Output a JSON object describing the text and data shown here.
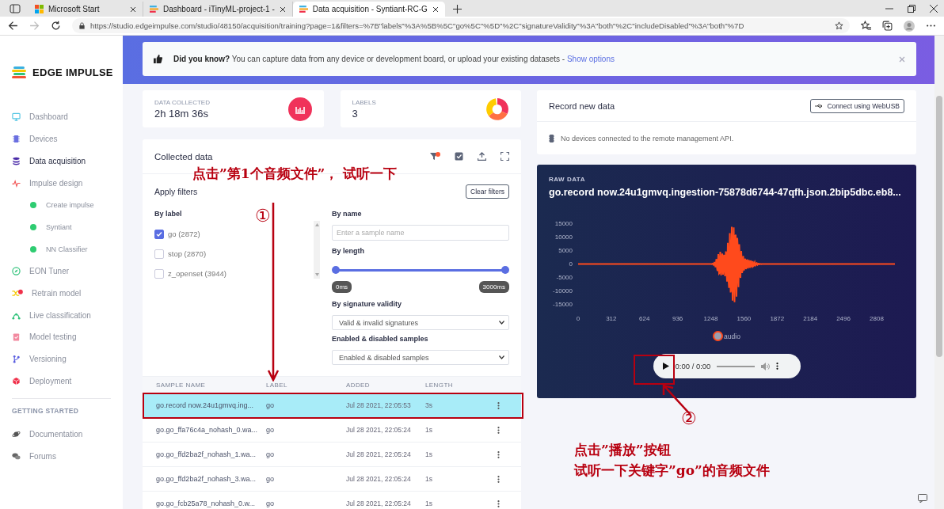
{
  "browser": {
    "tabs": [
      {
        "title": "Microsoft Start",
        "selected": false
      },
      {
        "title": "Dashboard - iTinyML-project-1 -",
        "selected": false
      },
      {
        "title": "Data acquisition - Syntiant-RC-G",
        "selected": true
      }
    ],
    "url": "https://studio.edgeimpulse.com/studio/48150/acquisition/training?page=1&filters=%7B\"labels\"%3A%5B%5C\"go%5C\"%5D\"%2C\"signatureValidity\"%3A\"both\"%2C\"includeDisabled\"%3A\"both\"%7D"
  },
  "sidebar": {
    "logo": "EDGE IMPULSE",
    "items": [
      {
        "label": "Dashboard",
        "selected": false
      },
      {
        "label": "Devices",
        "selected": false
      },
      {
        "label": "Data acquisition",
        "selected": true
      },
      {
        "label": "Impulse design",
        "selected": false,
        "children": [
          {
            "label": "Create impulse"
          },
          {
            "label": "Syntiant"
          },
          {
            "label": "NN Classifier"
          }
        ]
      },
      {
        "label": "EON Tuner",
        "selected": false
      },
      {
        "label": "Retrain model",
        "selected": false
      },
      {
        "label": "Live classification",
        "selected": false
      },
      {
        "label": "Model testing",
        "selected": false
      },
      {
        "label": "Versioning",
        "selected": false
      },
      {
        "label": "Deployment",
        "selected": false
      }
    ],
    "section_title": "GETTING STARTED",
    "links": [
      {
        "label": "Documentation"
      },
      {
        "label": "Forums"
      }
    ]
  },
  "banner": {
    "text": "**Did you know?** You can capture data from any device or development board, or upload your existing datasets - ",
    "link": "Show options"
  },
  "stats": [
    {
      "label": "DATA COLLECTED",
      "value": "2h 18m 36s"
    },
    {
      "label": "LABELS",
      "value": "3"
    }
  ],
  "collected": {
    "title": "Collected data",
    "filters": {
      "title": "Apply filters",
      "clear": "Clear filters",
      "by_label": "By label",
      "labels": [
        {
          "text": "go (2872)",
          "checked": true
        },
        {
          "text": "stop (2870)",
          "checked": false
        },
        {
          "text": "z_openset (3944)",
          "checked": false
        }
      ],
      "by_name": "By name",
      "name_placeholder": "Enter a sample name",
      "by_length": "By length",
      "length_range": {
        "level": 1,
        "min": "0ms",
        "max": "3000ms"
      },
      "by_signature": "By signature validity",
      "signature_value": "Valid & invalid signatures",
      "by_enabled": "Enabled & disabled samples",
      "enabled_value": "Enabled & disabled samples"
    },
    "table": {
      "columns": [
        "SAMPLE NAME",
        "LABEL",
        "ADDED",
        "LENGTH"
      ],
      "rows": [
        {
          "name": "go.record now.24u1gmvq.ing...",
          "label": "go",
          "added": "Jul 28 2021, 22:05:53",
          "length": "3s",
          "selected": true
        },
        {
          "name": "go.go_ffa76c4a_nohash_0.wa...",
          "label": "go",
          "added": "Jul 28 2021, 22:05:24",
          "length": "1s",
          "selected": false
        },
        {
          "name": "go.go_ffd2ba2f_nohash_1.wa...",
          "label": "go",
          "added": "Jul 28 2021, 22:05:24",
          "length": "1s",
          "selected": false
        },
        {
          "name": "go.go_ffd2ba2f_nohash_3.wa...",
          "label": "go",
          "added": "Jul 28 2021, 22:05:24",
          "length": "1s",
          "selected": false
        },
        {
          "name": "go.go_fcb25a78_nohash_0.w...",
          "label": "go",
          "added": "Jul 28 2021, 22:05:24",
          "length": "1s",
          "selected": false
        }
      ]
    }
  },
  "record": {
    "title": "Record new data",
    "button": "Connect using WebUSB",
    "message": "No devices connected to the remote management API."
  },
  "raw_data": {
    "label": "RAW DATA",
    "title": "go.record now.24u1gmvq.ingestion-75878d6744-47qfh.json.2bip5dbc.eb8...",
    "y_ticks": [
      "15000",
      "10000",
      "5000",
      "0",
      "-5000",
      "-10000",
      "-15000"
    ],
    "x_ticks": [
      "0",
      "312",
      "624",
      "936",
      "1248",
      "1560",
      "1872",
      "2184",
      "2496",
      "2808"
    ],
    "legend": "audio",
    "player": {
      "time": "0:00 / 0:00"
    }
  },
  "annotations": [
    {
      "marker": "①",
      "lines": [
        "点击”第1个音频文件”， 试听一下"
      ]
    },
    {
      "marker": "②",
      "lines": [
        "点击”播放”按钮",
        "试听一下关键字”go”的音频文件"
      ]
    }
  ]
}
